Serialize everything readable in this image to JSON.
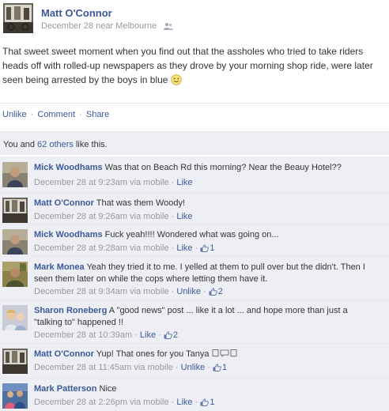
{
  "post": {
    "author": "Matt O'Connor",
    "meta": "December 28 near Melbourne",
    "text": "That sweet sweet moment when you find out that the assholes who tried to take riders heads off with rolled-up newspapers as they drove by your morning shop ride, were later seen being arrested by the boys in blue"
  },
  "actions": {
    "unlike": "Unlike",
    "comment": "Comment",
    "share": "Share",
    "separator": "·"
  },
  "likes": {
    "prefix": "You and ",
    "others": "62 others",
    "suffix": " like this."
  },
  "comments": [
    {
      "author": "Mick Woodhams",
      "text": "Was that on Beach Rd this morning? Near the Beauy Hotel??",
      "time": "December 28 at 9:23am via mobile",
      "action": "Like",
      "like_count": ""
    },
    {
      "author": "Matt O'Connor",
      "text": "That was them Woody!",
      "time": "December 28 at 9:26am via mobile",
      "action": "Like",
      "like_count": ""
    },
    {
      "author": "Mick Woodhams",
      "text": "Fuck yeah!!!! Wondered what was going on...",
      "time": "December 28 at 9:28am via mobile",
      "action": "Like",
      "like_count": "1"
    },
    {
      "author": "Mark Monea",
      "text": "Yeah they tried it to me. I yelled at them to pull over but the didn't. Then I seen them later on while the cops where letting them have it.",
      "time": "December 28 at 9:34am via mobile",
      "action": "Unlike",
      "like_count": "2"
    },
    {
      "author": "Sharon Roneberg",
      "text": "A \"good news\" post ... like it a lot ... and hope more than just a \"talking to\" happened !!",
      "time": "December 28 at 10:39am",
      "action": "Like",
      "like_count": "2"
    },
    {
      "author": "Matt O'Connor",
      "text": "Yup! That ones for you Tanya",
      "time": "December 28 at 11:45am via mobile",
      "action": "Unlike",
      "like_count": "1"
    },
    {
      "author": "Mark Patterson",
      "text": "Nice",
      "time": "December 28 at 2:26pm via mobile",
      "action": "Like",
      "like_count": "1"
    }
  ],
  "colors": {
    "link": "#3b5998",
    "meta": "#999999",
    "comment_bg": "#edeff4"
  }
}
